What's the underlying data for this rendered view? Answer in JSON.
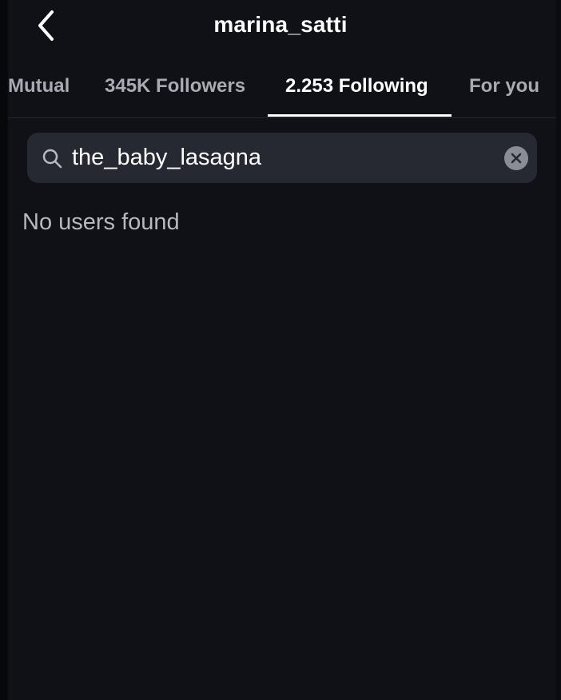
{
  "header": {
    "title": "marina_satti",
    "back_icon": "chevron-left-icon"
  },
  "tabs": [
    {
      "label": "Mutual",
      "active": false
    },
    {
      "label": "345K Followers",
      "active": false
    },
    {
      "label": "2.253 Following",
      "active": true
    },
    {
      "label": "For you",
      "active": false
    }
  ],
  "search": {
    "value": "the_baby_lasagna",
    "icon": "search-icon",
    "clear_icon": "clear-icon"
  },
  "results": {
    "empty_message": "No users found"
  },
  "colors": {
    "background": "#0f1117",
    "search_field": "#272932",
    "inactive_tab": "#a8abb3",
    "active_tab": "#ffffff",
    "muted_text": "#b7b9c0"
  }
}
